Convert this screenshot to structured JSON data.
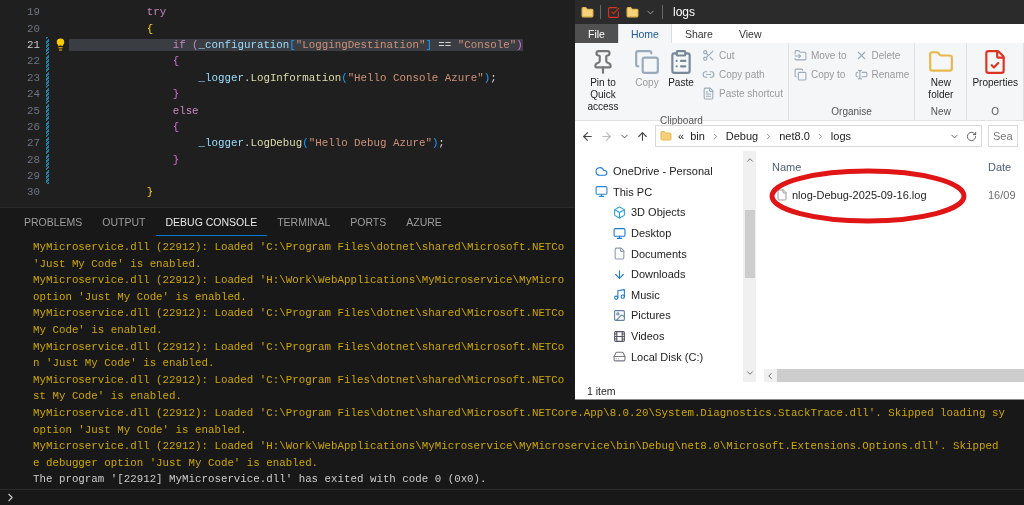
{
  "editor": {
    "lines": [
      {
        "number": "19",
        "active": false,
        "changed": false,
        "tokens": [
          {
            "text": "            try",
            "kind": "keyword"
          }
        ]
      },
      {
        "number": "20",
        "active": false,
        "changed": false,
        "tokens": [
          {
            "text": "            {",
            "kind": "bracket1"
          }
        ]
      },
      {
        "number": "21",
        "active": true,
        "changed": true,
        "tokens": [
          {
            "text": "                if (",
            "kind": "keyword"
          },
          {
            "text": "_configuration",
            "kind": "variable"
          },
          {
            "text": "[",
            "kind": "bracket3"
          },
          {
            "text": "\"LoggingDestination\"",
            "kind": "string"
          },
          {
            "text": "]",
            "kind": "bracket3"
          },
          {
            "text": " == ",
            "kind": "plain"
          },
          {
            "text": "\"Console\"",
            "kind": "string"
          },
          {
            "text": ")",
            "kind": "bracket2"
          }
        ]
      },
      {
        "number": "22",
        "active": false,
        "changed": true,
        "tokens": [
          {
            "text": "                {",
            "kind": "bracket2"
          }
        ]
      },
      {
        "number": "23",
        "active": false,
        "changed": true,
        "tokens": [
          {
            "text": "                    _logger",
            "kind": "variable"
          },
          {
            "text": ".",
            "kind": "plain"
          },
          {
            "text": "LogInformation",
            "kind": "method"
          },
          {
            "text": "(",
            "kind": "bracket3"
          },
          {
            "text": "\"Hello Console Azure\"",
            "kind": "string"
          },
          {
            "text": ")",
            "kind": "bracket3"
          },
          {
            "text": ";",
            "kind": "plain"
          }
        ]
      },
      {
        "number": "24",
        "active": false,
        "changed": true,
        "tokens": [
          {
            "text": "                }",
            "kind": "bracket2"
          }
        ]
      },
      {
        "number": "25",
        "active": false,
        "changed": true,
        "tokens": [
          {
            "text": "                else",
            "kind": "keyword"
          }
        ]
      },
      {
        "number": "26",
        "active": false,
        "changed": true,
        "tokens": [
          {
            "text": "                {",
            "kind": "bracket2"
          }
        ]
      },
      {
        "number": "27",
        "active": false,
        "changed": true,
        "tokens": [
          {
            "text": "                    _logger",
            "kind": "variable"
          },
          {
            "text": ".",
            "kind": "plain"
          },
          {
            "text": "LogDebug",
            "kind": "method"
          },
          {
            "text": "(",
            "kind": "bracket3"
          },
          {
            "text": "\"Hello Debug Azure\"",
            "kind": "string"
          },
          {
            "text": ")",
            "kind": "bracket3"
          },
          {
            "text": ";",
            "kind": "plain"
          }
        ]
      },
      {
        "number": "28",
        "active": false,
        "changed": true,
        "tokens": [
          {
            "text": "                }",
            "kind": "bracket2"
          }
        ]
      },
      {
        "number": "29",
        "active": false,
        "changed": true
      },
      {
        "number": "30",
        "active": false,
        "changed": false,
        "tokens": [
          {
            "text": "            }",
            "kind": "bracket1"
          }
        ]
      }
    ]
  },
  "panel": {
    "tabs": [
      {
        "label": "PROBLEMS",
        "selected": false
      },
      {
        "label": "OUTPUT",
        "selected": false
      },
      {
        "label": "DEBUG CONSOLE",
        "selected": true
      },
      {
        "label": "TERMINAL",
        "selected": false
      },
      {
        "label": "PORTS",
        "selected": false
      },
      {
        "label": "AZURE",
        "selected": false
      }
    ],
    "console_lines": [
      {
        "kind": "log",
        "text": "MyMicroservice.dll (22912): Loaded 'C:\\Program Files\\dotnet\\shared\\Microsoft.NETCo"
      },
      {
        "kind": "log",
        "text": "'Just My Code' is enabled."
      },
      {
        "kind": "log",
        "text": "MyMicroservice.dll (22912): Loaded 'H:\\Work\\WebApplications\\MyMicroservice\\MyMicro"
      },
      {
        "kind": "log",
        "text": "option 'Just My Code' is enabled."
      },
      {
        "kind": "log",
        "text": "MyMicroservice.dll (22912): Loaded 'C:\\Program Files\\dotnet\\shared\\Microsoft.NETCo"
      },
      {
        "kind": "log",
        "text": "My Code' is enabled."
      },
      {
        "kind": "log",
        "text": "MyMicroservice.dll (22912): Loaded 'C:\\Program Files\\dotnet\\shared\\Microsoft.NETCo"
      },
      {
        "kind": "log",
        "text": "n 'Just My Code' is enabled."
      },
      {
        "kind": "log",
        "text": "MyMicroservice.dll (22912): Loaded 'C:\\Program Files\\dotnet\\shared\\Microsoft.NETCo"
      },
      {
        "kind": "log",
        "text": "st My Code' is enabled."
      },
      {
        "kind": "log",
        "text": "MyMicroservice.dll (22912): Loaded 'C:\\Program Files\\dotnet\\shared\\Microsoft.NETCore.App\\8.0.20\\System.Diagnostics.StackTrace.dll'. Skipped loading sy"
      },
      {
        "kind": "log",
        "text": "option 'Just My Code' is enabled."
      },
      {
        "kind": "log",
        "text": "MyMicroservice.dll (22912): Loaded 'H:\\Work\\WebApplications\\MyMicroservice\\MyMicroservice\\bin\\Debug\\net8.0\\Microsoft.Extensions.Options.dll'. Skipped"
      },
      {
        "kind": "log",
        "text": "e debugger option 'Just My Code' is enabled."
      },
      {
        "kind": "exit",
        "text": "The program '[22912] MyMicroservice.dll' has exited with code 0 (0x0)."
      }
    ]
  },
  "explorer": {
    "title": "logs",
    "ribbon_tabs": [
      {
        "label": "File",
        "selected": false,
        "kind": "file"
      },
      {
        "label": "Home",
        "selected": true,
        "kind": "tab"
      },
      {
        "label": "Share",
        "selected": false,
        "kind": "tab"
      },
      {
        "label": "View",
        "selected": false,
        "kind": "tab"
      }
    ],
    "groups": [
      {
        "label": "Clipboard",
        "large": [
          {
            "label": "Pin to Quick access",
            "disabled": false
          },
          {
            "label": "Copy",
            "disabled": true
          },
          {
            "label": "Paste",
            "disabled": false
          }
        ],
        "small": [
          {
            "label": "Cut",
            "disabled": true
          },
          {
            "label": "Copy path",
            "disabled": true
          },
          {
            "label": "Paste shortcut",
            "disabled": true
          }
        ]
      },
      {
        "label": "Organise",
        "small": [
          {
            "label": "Move to",
            "disabled": true
          },
          {
            "label": "Copy to",
            "disabled": true
          }
        ],
        "small2": [
          {
            "label": "Delete",
            "disabled": true
          },
          {
            "label": "Rename",
            "disabled": true
          }
        ]
      },
      {
        "label": "New",
        "large": [
          {
            "label": "New folder",
            "disabled": false
          }
        ]
      },
      {
        "label": "O",
        "large": [
          {
            "label": "Properties",
            "disabled": false
          }
        ]
      }
    ],
    "breadcrumbs": [
      "«",
      "bin",
      "Debug",
      "net8.0",
      "logs"
    ],
    "search": {
      "placeholder": "Sea"
    },
    "nav": [
      {
        "label": "OneDrive - Personal"
      },
      {
        "label": "This PC",
        "children": [
          {
            "label": "3D Objects"
          },
          {
            "label": "Desktop"
          },
          {
            "label": "Documents"
          },
          {
            "label": "Downloads"
          },
          {
            "label": "Music"
          },
          {
            "label": "Pictures"
          },
          {
            "label": "Videos"
          },
          {
            "label": "Local Disk (C:)"
          }
        ]
      }
    ],
    "columns": [
      "Name",
      "Date"
    ],
    "files": [
      {
        "name": "nlog-Debug-2025-09-16.log",
        "date": "16/09",
        "circled": true
      }
    ],
    "status": "1 item"
  }
}
